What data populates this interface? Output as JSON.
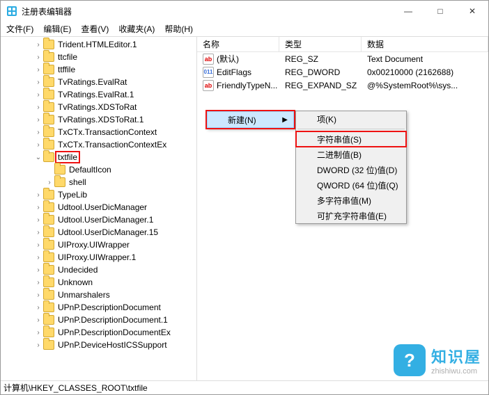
{
  "window": {
    "title": "注册表编辑器",
    "min": "—",
    "max": "□",
    "close": "✕"
  },
  "menubar": {
    "file": "文件(F)",
    "edit": "编辑(E)",
    "view": "查看(V)",
    "fav": "收藏夹(A)",
    "help": "帮助(H)"
  },
  "tree": [
    {
      "d": 3,
      "e": "›",
      "l": "Trident.HTMLEditor.1"
    },
    {
      "d": 3,
      "e": "›",
      "l": "ttcfile"
    },
    {
      "d": 3,
      "e": "›",
      "l": "ttffile"
    },
    {
      "d": 3,
      "e": "›",
      "l": "TvRatings.EvalRat"
    },
    {
      "d": 3,
      "e": "›",
      "l": "TvRatings.EvalRat.1"
    },
    {
      "d": 3,
      "e": "›",
      "l": "TvRatings.XDSToRat"
    },
    {
      "d": 3,
      "e": "›",
      "l": "TvRatings.XDSToRat.1"
    },
    {
      "d": 3,
      "e": "›",
      "l": "TxCTx.TransactionContext"
    },
    {
      "d": 3,
      "e": "›",
      "l": "TxCTx.TransactionContextEx"
    },
    {
      "d": 3,
      "e": "⌄",
      "l": "txtfile",
      "boxed": true
    },
    {
      "d": 4,
      "e": " ",
      "l": "DefaultIcon"
    },
    {
      "d": 4,
      "e": "›",
      "l": "shell"
    },
    {
      "d": 3,
      "e": "›",
      "l": "TypeLib"
    },
    {
      "d": 3,
      "e": "›",
      "l": "Udtool.UserDicManager"
    },
    {
      "d": 3,
      "e": "›",
      "l": "Udtool.UserDicManager.1"
    },
    {
      "d": 3,
      "e": "›",
      "l": "Udtool.UserDicManager.15"
    },
    {
      "d": 3,
      "e": "›",
      "l": "UIProxy.UIWrapper"
    },
    {
      "d": 3,
      "e": "›",
      "l": "UIProxy.UIWrapper.1"
    },
    {
      "d": 3,
      "e": "›",
      "l": "Undecided"
    },
    {
      "d": 3,
      "e": "›",
      "l": "Unknown"
    },
    {
      "d": 3,
      "e": "›",
      "l": "Unmarshalers"
    },
    {
      "d": 3,
      "e": "›",
      "l": "UPnP.DescriptionDocument"
    },
    {
      "d": 3,
      "e": "›",
      "l": "UPnP.DescriptionDocument.1"
    },
    {
      "d": 3,
      "e": "›",
      "l": "UPnP.DescriptionDocumentEx"
    },
    {
      "d": 3,
      "e": "›",
      "l": "UPnP.DeviceHostICSSupport"
    }
  ],
  "listHeader": {
    "name": "名称",
    "type": "类型",
    "data": "数据"
  },
  "listRows": [
    {
      "icon": "str",
      "name": "(默认)",
      "type": "REG_SZ",
      "data": "Text Document"
    },
    {
      "icon": "bin",
      "name": "EditFlags",
      "type": "REG_DWORD",
      "data": "0x00210000 (2162688)"
    },
    {
      "icon": "str",
      "name": "FriendlyTypeN...",
      "type": "REG_EXPAND_SZ",
      "data": "@%SystemRoot%\\sys..."
    }
  ],
  "menu1": {
    "new": "新建(N)"
  },
  "menu2": {
    "key": "项(K)",
    "string": "字符串值(S)",
    "binary": "二进制值(B)",
    "dword": "DWORD (32 位)值(D)",
    "qword": "QWORD (64 位)值(Q)",
    "multi": "多字符串值(M)",
    "expand": "可扩充字符串值(E)"
  },
  "status": "计算机\\HKEY_CLASSES_ROOT\\txtfile",
  "watermark": {
    "name": "知识屋",
    "url": "zhishiwu.com"
  }
}
